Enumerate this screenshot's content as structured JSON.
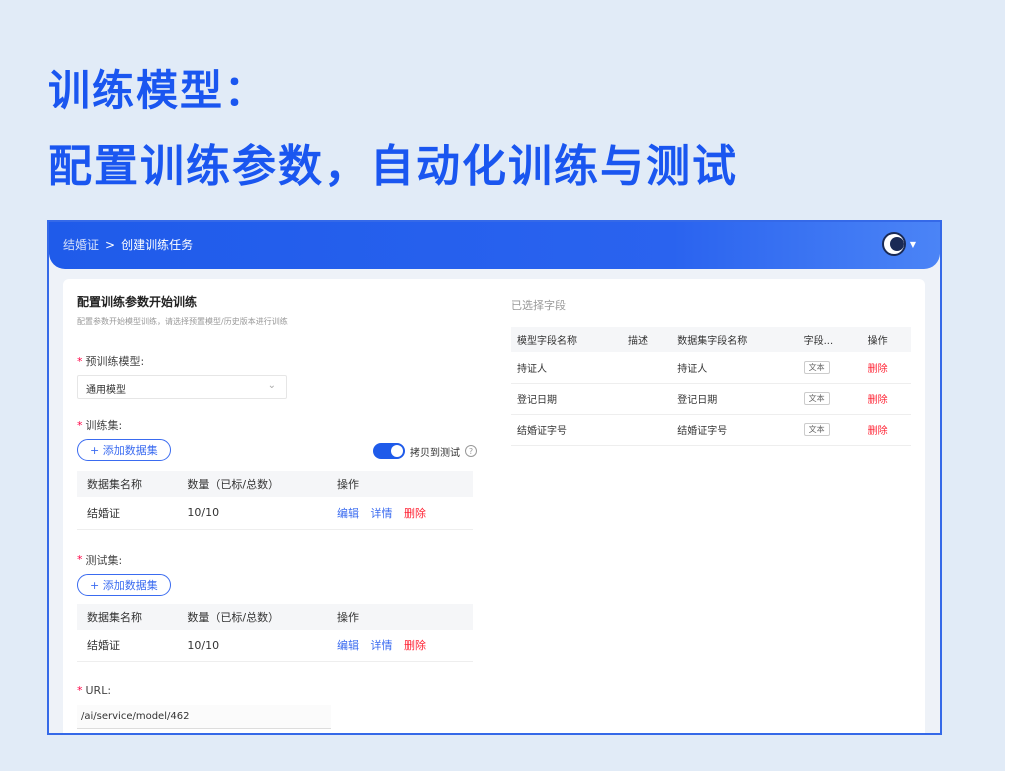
{
  "headline": {
    "line1": "训练模型：",
    "line2": "配置训练参数，自动化训练与测试"
  },
  "topbar": {
    "breadcrumb_root": "结婚证",
    "breadcrumb_separator": ">",
    "breadcrumb_current": "创建训练任务",
    "avatar_icon": "user-avatar"
  },
  "form": {
    "title": "配置训练参数开始训练",
    "subtitle": "配置参数开始模型训练，请选择预置模型/历史版本进行训练",
    "pretrain_label": "预训练模型:",
    "pretrain_value": "通用模型",
    "train_label": "训练集:",
    "add_dataset": "+ 添加数据集",
    "copy_to_test": "拷贝到测试",
    "train_table": {
      "headers": [
        "数据集名称",
        "数量（已标/总数）",
        "操作"
      ],
      "rows": [
        {
          "name": "结婚证",
          "count": "10/10",
          "edit": "编辑",
          "detail": "详情",
          "delete": "删除"
        }
      ]
    },
    "test_label": "测试集:",
    "add_dataset_test": "+ 添加数据集",
    "test_table": {
      "headers": [
        "数据集名称",
        "数量（已标/总数）",
        "操作"
      ],
      "rows": [
        {
          "name": "结婚证",
          "count": "10/10",
          "edit": "编辑",
          "detail": "详情",
          "delete": "删除"
        }
      ]
    },
    "url_label": "URL:",
    "url_value": "/ai/service/model/462"
  },
  "selected_fields": {
    "title": "已选择字段",
    "headers": [
      "模型字段名称",
      "描述",
      "数据集字段名称",
      "字段...",
      "操作"
    ],
    "rows": [
      {
        "model_field": "持证人",
        "desc": "",
        "dataset_field": "持证人",
        "type": "文本",
        "action": "删除"
      },
      {
        "model_field": "登记日期",
        "desc": "",
        "dataset_field": "登记日期",
        "type": "文本",
        "action": "删除"
      },
      {
        "model_field": "结婚证字号",
        "desc": "",
        "dataset_field": "结婚证字号",
        "type": "文本",
        "action": "删除"
      }
    ]
  }
}
